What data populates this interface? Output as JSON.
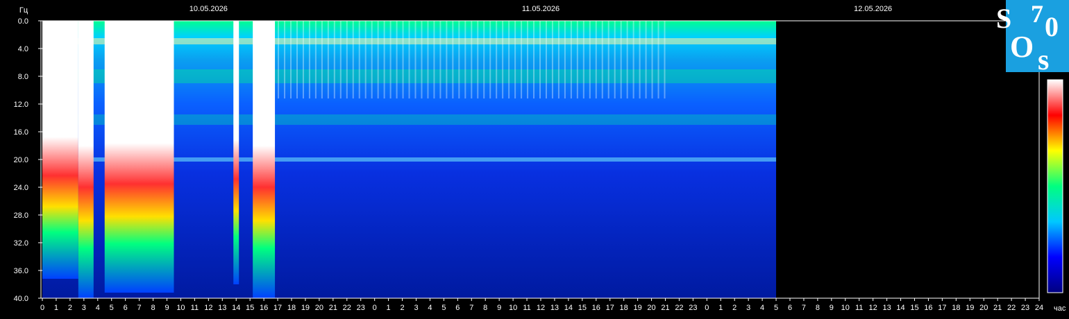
{
  "logo": {
    "text": "SOS 70",
    "color": "#1aa0e0"
  },
  "chart_data": {
    "type": "heatmap",
    "title": "",
    "y_unit_label": "Гц",
    "x_unit_label": "час",
    "ylim": [
      0,
      40
    ],
    "y_ticks": [
      "0.0",
      "4.0",
      "8.0",
      "12.0",
      "16.0",
      "20.0",
      "24.0",
      "28.0",
      "32.0",
      "36.0",
      "40.0"
    ],
    "dates": [
      {
        "label": "10.05.2026",
        "at_hour": 12
      },
      {
        "label": "11.05.2026",
        "at_hour": 36
      },
      {
        "label": "12.05.2026",
        "at_hour": 60
      }
    ],
    "x_range_hours": [
      0,
      72
    ],
    "x_tick_labels": [
      "0",
      "1",
      "2",
      "3",
      "4",
      "5",
      "6",
      "7",
      "8",
      "9",
      "10",
      "11",
      "12",
      "13",
      "14",
      "15",
      "16",
      "17",
      "18",
      "19",
      "20",
      "21",
      "22",
      "23",
      "0",
      "1",
      "2",
      "3",
      "4",
      "5",
      "6",
      "7",
      "8",
      "9",
      "10",
      "11",
      "12",
      "13",
      "14",
      "15",
      "16",
      "17",
      "18",
      "19",
      "20",
      "21",
      "22",
      "23",
      "0",
      "1",
      "2",
      "3",
      "4",
      "5",
      "6",
      "7",
      "8",
      "9",
      "10",
      "11",
      "12",
      "13",
      "14",
      "15",
      "16",
      "17",
      "18",
      "19",
      "20",
      "21",
      "22",
      "23",
      "24"
    ],
    "data_end_hour": 53,
    "colormap": [
      "#000080",
      "#0000ff",
      "#00c8ff",
      "#00ff80",
      "#ffff00",
      "#ff0000",
      "#ffffff"
    ],
    "hotspots_hours": [
      {
        "from": 0,
        "to": 2.6,
        "level": 0.93
      },
      {
        "from": 2.6,
        "to": 3.7,
        "level": 1.0
      },
      {
        "from": 4.5,
        "to": 9.5,
        "level": 0.98
      },
      {
        "from": 13.8,
        "to": 14.2,
        "level": 0.95
      },
      {
        "from": 15.2,
        "to": 16.8,
        "level": 1.0
      }
    ]
  }
}
